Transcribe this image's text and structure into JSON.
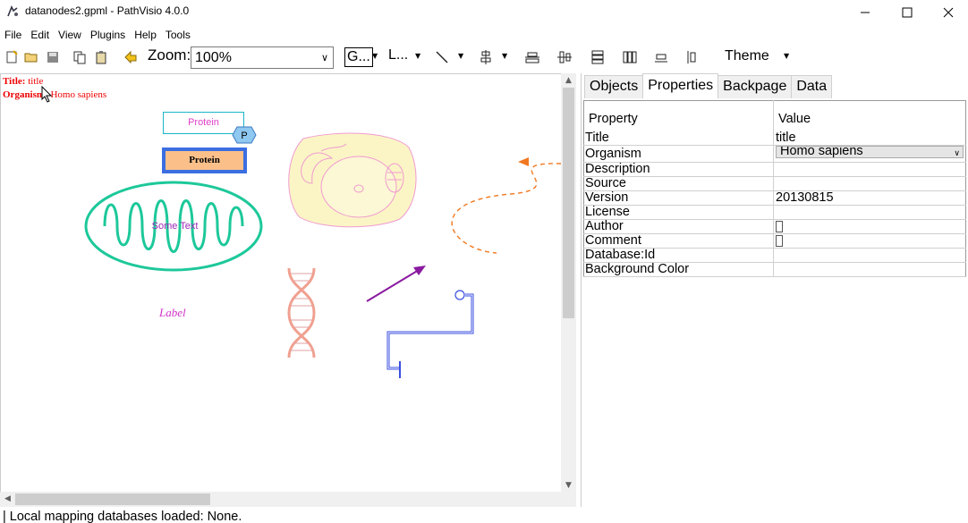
{
  "window": {
    "title": "datanodes2.gpml - PathVisio 4.0.0",
    "minimize_glyph": "—",
    "maximize_glyph": "☐",
    "close_glyph": "✕"
  },
  "menu": [
    "File",
    "Edit",
    "View",
    "Plugins",
    "Help",
    "Tools"
  ],
  "toolbar": {
    "zoom_label": "Zoom:",
    "zoom_value": "100%",
    "group_label": "G...",
    "layout_label": "L...",
    "theme_label": "Theme",
    "icons": [
      "new-file-icon",
      "open-folder-icon",
      "save-icon",
      "copy-icon",
      "paste-icon",
      "undo-icon"
    ]
  },
  "canvas": {
    "title_label": "Title:",
    "title_value": "title",
    "organism_label": "Organism:",
    "organism_value": "Homo sapiens",
    "protein_1": "Protein",
    "phospho_badge": "P",
    "protein_2": "Protein",
    "mitochondrion_text": "Some Text",
    "label_text": "Label",
    "colors": {
      "protein_border": "#1ab5c6",
      "protein_text": "#e040c8",
      "protein2_fill": "#fbc08a",
      "protein2_border": "#3b6ee0",
      "mito_stroke": "#1dc89a",
      "cell_fill": "#fbf5c6",
      "cell_stroke": "#f09bd0",
      "arrow_purple": "#8a1aa0",
      "dashed_orange": "#f07820",
      "blue_line": "#3a4ee0"
    }
  },
  "panel": {
    "tabs": [
      "Objects",
      "Properties",
      "Backpage",
      "Data"
    ],
    "active_tab": "Properties",
    "header": {
      "property": "Property",
      "value": "Value"
    },
    "rows": [
      {
        "property": "Title",
        "value": "title"
      },
      {
        "property": "Organism",
        "value": "Homo sapiens"
      },
      {
        "property": "Description",
        "value": ""
      },
      {
        "property": "Source",
        "value": ""
      },
      {
        "property": "Version",
        "value": "20130815"
      },
      {
        "property": "License",
        "value": ""
      },
      {
        "property": "Author",
        "value": ""
      },
      {
        "property": "Comment",
        "value": ""
      },
      {
        "property": "Database:Id",
        "value": ""
      },
      {
        "property": "Background Color",
        "value": ""
      }
    ]
  },
  "status": "| Local mapping databases loaded: None."
}
